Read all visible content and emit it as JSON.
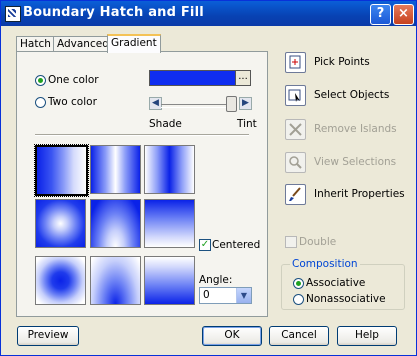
{
  "window": {
    "title": "Boundary Hatch and Fill",
    "help_label": "?",
    "close_label": "×"
  },
  "tabs": [
    {
      "label": "Hatch"
    },
    {
      "label": "Advanced"
    },
    {
      "label": "Gradient",
      "active": true
    }
  ],
  "gradient": {
    "one_color_label": "One color",
    "two_color_label": "Two color",
    "selected_mode": "one_color",
    "color_hex": "#0f2df0",
    "ellipsis_label": "...",
    "shade_label": "Shade",
    "tint_label": "Tint",
    "slider_value": 0.9,
    "centered_label": "Centered",
    "centered_checked": true,
    "angle_label": "Angle:",
    "angle_value": "0",
    "patterns": [
      {
        "name": "linear",
        "selected": true
      },
      {
        "name": "cylinder"
      },
      {
        "name": "inverted-cylinder"
      },
      {
        "name": "spherical"
      },
      {
        "name": "hemispherical"
      },
      {
        "name": "curved"
      },
      {
        "name": "inverted-spherical"
      },
      {
        "name": "inverted-hemispherical"
      },
      {
        "name": "inverted-curved"
      }
    ]
  },
  "actions": {
    "pick_points": "Pick Points",
    "select_objects": "Select Objects",
    "remove_islands": "Remove Islands",
    "view_selections": "View Selections",
    "inherit_properties": "Inherit Properties",
    "double_label": "Double"
  },
  "composition": {
    "title": "Composition",
    "associative": "Associative",
    "nonassociative": "Nonassociative",
    "selected": "associative"
  },
  "buttons": {
    "preview": "Preview",
    "ok": "OK",
    "cancel": "Cancel",
    "help": "Help"
  },
  "colors": {
    "accent_blue": "#0f2df0",
    "title_bar": "#0842b3",
    "group_title": "#0046d5"
  }
}
